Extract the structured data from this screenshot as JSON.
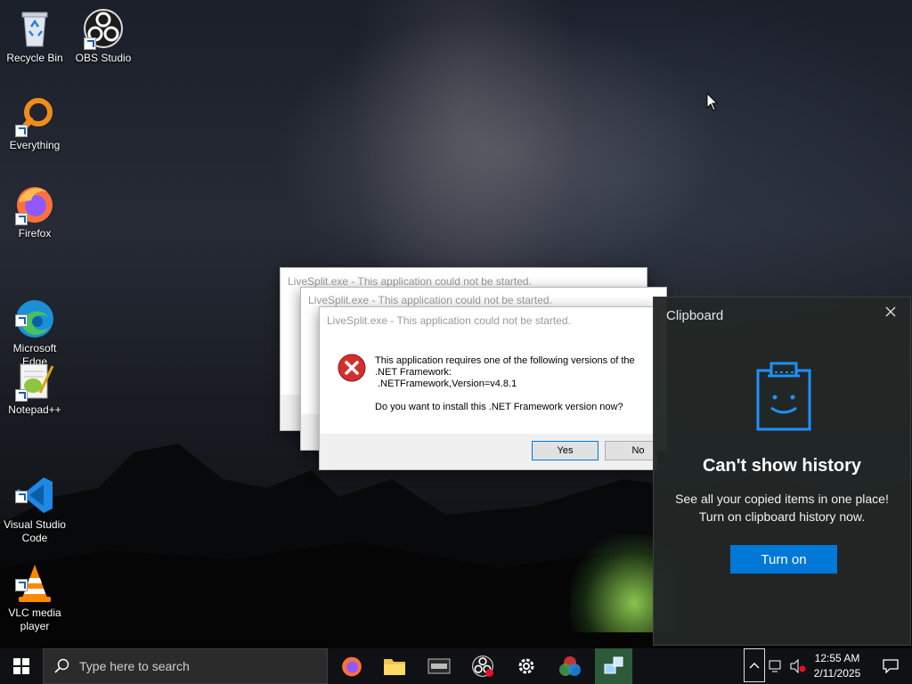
{
  "desktop": {
    "icons": [
      {
        "label": "Recycle Bin",
        "icon": "recycle-bin-icon"
      },
      {
        "label": "OBS Studio",
        "icon": "obs-icon"
      },
      {
        "label": "Everything",
        "icon": "everything-search-icon"
      },
      {
        "label": "Firefox",
        "icon": "firefox-icon"
      },
      {
        "label": "Microsoft\nEdge",
        "icon": "edge-icon"
      },
      {
        "label": "Notepad++",
        "icon": "notepadpp-icon"
      },
      {
        "label": "Visual Studio\nCode",
        "icon": "vscode-icon"
      },
      {
        "label": "VLC media\nplayer",
        "icon": "vlc-icon"
      }
    ]
  },
  "dialogs": {
    "back_title": "LiveSplit.exe - This application could not be started.",
    "mid_title": "LiveSplit.exe - This application could not be started.",
    "front": {
      "title": "LiveSplit.exe - This application could not be started.",
      "message_line1": "This application requires one of the following versions of the",
      "message_line2": ".NET Framework:",
      "message_line3": ".NETFramework,Version=v4.8.1",
      "question": "Do you want to install this .NET Framework version now?",
      "yes_label": "Yes",
      "no_label": "No"
    }
  },
  "clipboard": {
    "title": "Clipboard",
    "heading": "Can't show history",
    "line1": "See all your copied items in one place!",
    "line2": "Turn on clipboard history now.",
    "button_label": "Turn on",
    "accent": "#0078d7"
  },
  "taskbar": {
    "search_placeholder": "Type here to search",
    "time": "12:55 AM",
    "date": "2/11/2025",
    "pinned": [
      "firefox-icon",
      "file-explorer-icon",
      "terminal-icon",
      "obs-icon",
      "settings-icon",
      "color-app-icon",
      "network-app-icon"
    ]
  }
}
